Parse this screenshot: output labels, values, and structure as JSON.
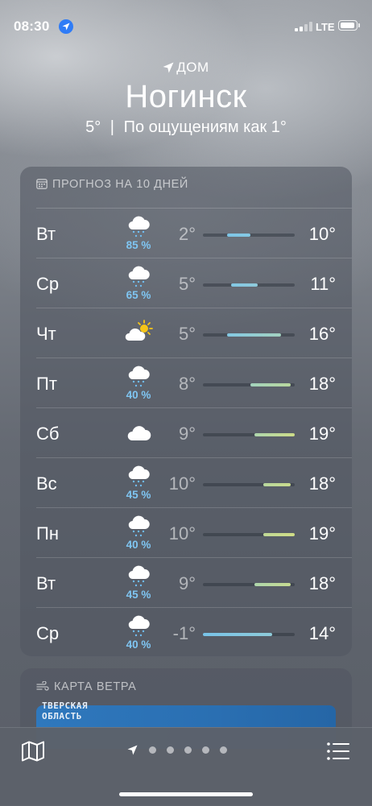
{
  "status_bar": {
    "time": "08:30",
    "network": "LTE"
  },
  "header": {
    "home_label": "ДОМ",
    "city": "Ногинск",
    "current_temp": "5°",
    "separator": "|",
    "feels_like": "По ощущениям как 1°"
  },
  "forecast": {
    "title": "ПРОГНОЗ НА 10 ДНЕЙ",
    "days": [
      {
        "day": "Вт",
        "icon": "cloud-rain-icon",
        "precip": "85 %",
        "low": "2°",
        "high": "10°",
        "bar_start": 0.26,
        "bar_end": 0.52,
        "bar_colors": [
          "#7dc5e6",
          "#85c9e3"
        ]
      },
      {
        "day": "Ср",
        "icon": "cloud-rain-icon",
        "precip": "65 %",
        "low": "5°",
        "high": "11°",
        "bar_start": 0.31,
        "bar_end": 0.6,
        "bar_colors": [
          "#82c7e4",
          "#8fcadb"
        ]
      },
      {
        "day": "Чт",
        "icon": "sun-cloud-icon",
        "precip": "",
        "low": "5°",
        "high": "16°",
        "bar_start": 0.26,
        "bar_end": 0.85,
        "bar_colors": [
          "#83c8e3",
          "#a3d2c0"
        ]
      },
      {
        "day": "Пт",
        "icon": "cloud-rain-icon",
        "precip": "40 %",
        "low": "8°",
        "high": "18°",
        "bar_start": 0.52,
        "bar_end": 0.96,
        "bar_colors": [
          "#a2d3bd",
          "#b9d89d"
        ]
      },
      {
        "day": "Сб",
        "icon": "cloud-icon",
        "precip": "",
        "low": "9°",
        "high": "19°",
        "bar_start": 0.56,
        "bar_end": 1.0,
        "bar_colors": [
          "#aed6ad",
          "#cddc88"
        ]
      },
      {
        "day": "Вс",
        "icon": "cloud-rain-icon",
        "precip": "45 %",
        "low": "10°",
        "high": "18°",
        "bar_start": 0.66,
        "bar_end": 0.96,
        "bar_colors": [
          "#b8d89e",
          "#c9db8c"
        ]
      },
      {
        "day": "Пн",
        "icon": "cloud-rain-icon",
        "precip": "40 %",
        "low": "10°",
        "high": "19°",
        "bar_start": 0.66,
        "bar_end": 1.0,
        "bar_colors": [
          "#c0d996",
          "#d0dd86"
        ]
      },
      {
        "day": "Вт",
        "icon": "cloud-rain-icon",
        "precip": "45 %",
        "low": "9°",
        "high": "18°",
        "bar_start": 0.56,
        "bar_end": 0.96,
        "bar_colors": [
          "#aed6ac",
          "#c6da90"
        ]
      },
      {
        "day": "Ср",
        "icon": "cloud-rain-icon",
        "precip": "40 %",
        "low": "-1°",
        "high": "14°",
        "bar_start": 0.0,
        "bar_end": 0.75,
        "bar_colors": [
          "#78c3e8",
          "#8ecbd9"
        ]
      }
    ]
  },
  "wind_map": {
    "title": "КАРТА ВЕТРА",
    "region_label_line1": "ТВЕРСКАЯ",
    "region_label_line2": "ОБЛАСТЬ"
  },
  "toolbar": {
    "page_dots": 5
  }
}
